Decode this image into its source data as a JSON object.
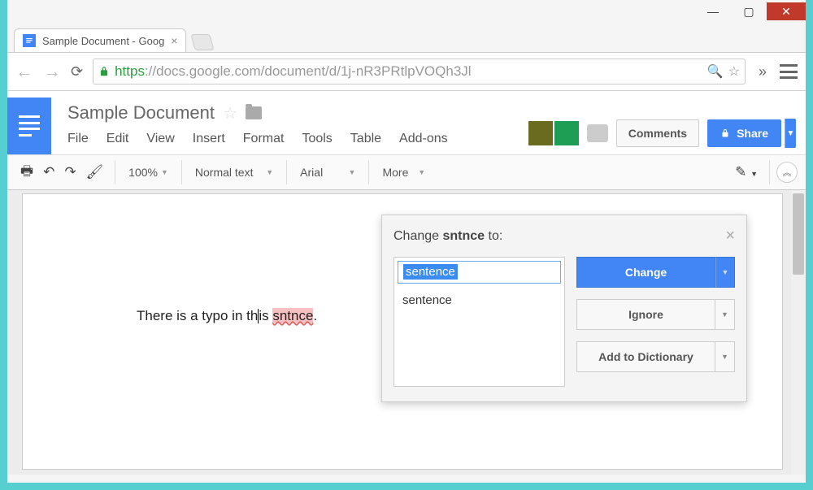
{
  "browser": {
    "tab_title": "Sample Document - Goog",
    "url_scheme": "https",
    "url_host": "://docs.google.com",
    "url_path": "/document/d/1j-nR3PRtlpVOQh3Jl"
  },
  "doc": {
    "title": "Sample Document",
    "menus": [
      "File",
      "Edit",
      "View",
      "Insert",
      "Format",
      "Tools",
      "Table",
      "Add-ons"
    ],
    "comments_label": "Comments",
    "share_label": "Share"
  },
  "toolbar": {
    "zoom": "100%",
    "style": "Normal text",
    "font": "Arial",
    "more": "More"
  },
  "content": {
    "before": "There is a typo in th",
    "mid": "is ",
    "typo": "sntnce",
    "after": "."
  },
  "spell": {
    "prompt_prefix": "Change ",
    "prompt_word": "sntnce",
    "prompt_suffix": " to:",
    "input_value": "sentence",
    "suggestions": [
      "sentence"
    ],
    "change": "Change",
    "ignore": "Ignore",
    "add": "Add to Dictionary"
  }
}
